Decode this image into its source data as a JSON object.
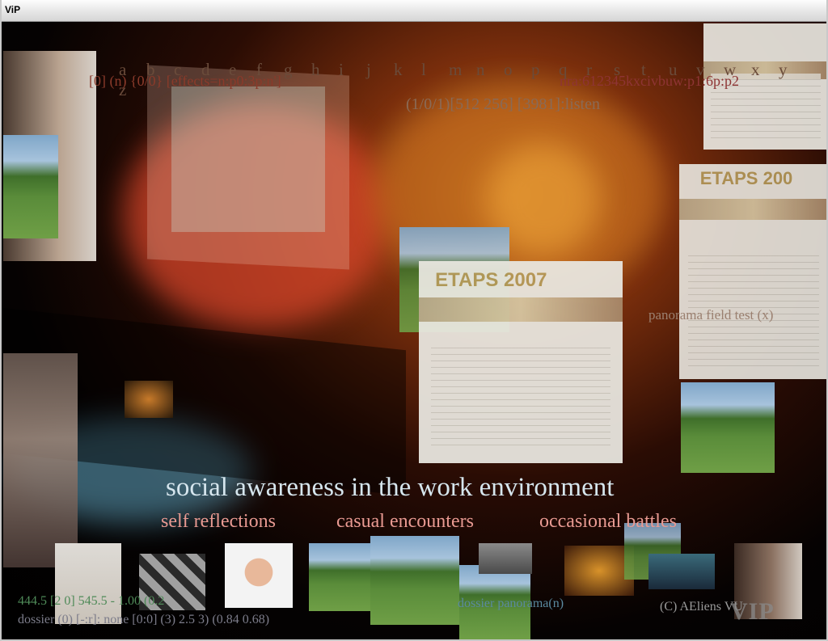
{
  "window": {
    "title": "ViP"
  },
  "alphabet": [
    "a",
    "b",
    "c",
    "d",
    "e",
    "f",
    "g",
    "h",
    "i",
    "j",
    "k",
    "l",
    "m",
    "n",
    "o",
    "p",
    "q",
    "r",
    "s",
    "t",
    "u",
    "v",
    "w",
    "x",
    "y",
    "z"
  ],
  "overlay": {
    "status_left": "[0] (n) {0/0} [effects=n:p0:3p:n']",
    "status_right": "nra:612345kxcivbuw:p1:6p:p2",
    "status_mid": "(1/0/1)[512 256] [3981]:listen",
    "panorama_label": "panorama field test (x)"
  },
  "cards": {
    "etaps_heading": "ETAPS 2007",
    "etaps_heading_short": "ETAPS 200"
  },
  "captions": {
    "headline": "social awareness in the work environment",
    "sub1": "self reflections",
    "sub2": "casual encounters",
    "sub3": "occasional battles"
  },
  "footer": {
    "coords": "444.5 [2 0] 545.5 - 1.00 (0.2",
    "dossier_line": "dossier (0) [-:r]: none [0:0] (3) 2.5 3) (0.84 0.68)",
    "dossier_panorama": "dossier panorama(n)",
    "copyright": "(C) AEliens VU",
    "logo": "VIP"
  },
  "colors": {
    "accent_pink": "#e99a92",
    "headline": "#d6e6ee",
    "status_green": "#4f8a58"
  }
}
